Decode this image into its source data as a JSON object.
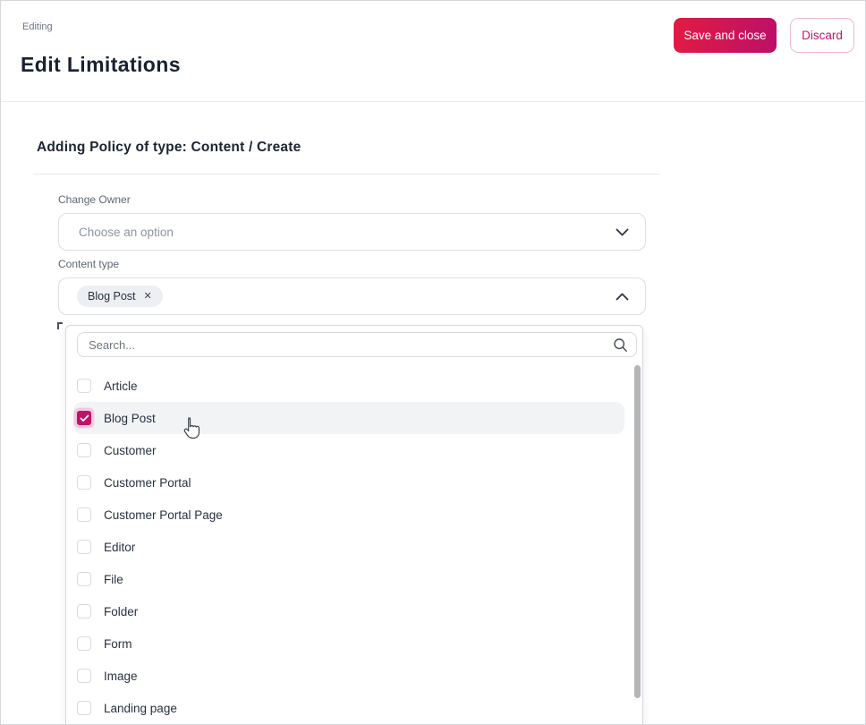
{
  "header": {
    "breadcrumb": "Editing",
    "title": "Edit Limitations",
    "save_label": "Save and close",
    "discard_label": "Discard"
  },
  "form": {
    "section_title": "Adding Policy of type: Content / Create",
    "change_owner_label": "Change Owner",
    "change_owner_placeholder": "Choose an option",
    "content_type_label": "Content type",
    "selected_content_type": "Blog Post"
  },
  "dropdown": {
    "search_placeholder": "Search...",
    "options": [
      {
        "label": "Article",
        "checked": false,
        "highlighted": false
      },
      {
        "label": "Blog Post",
        "checked": true,
        "highlighted": true
      },
      {
        "label": "Customer",
        "checked": false,
        "highlighted": false
      },
      {
        "label": "Customer Portal",
        "checked": false,
        "highlighted": false
      },
      {
        "label": "Customer Portal Page",
        "checked": false,
        "highlighted": false
      },
      {
        "label": "Editor",
        "checked": false,
        "highlighted": false
      },
      {
        "label": "File",
        "checked": false,
        "highlighted": false
      },
      {
        "label": "Folder",
        "checked": false,
        "highlighted": false
      },
      {
        "label": "Form",
        "checked": false,
        "highlighted": false
      },
      {
        "label": "Image",
        "checked": false,
        "highlighted": false
      },
      {
        "label": "Landing page",
        "checked": false,
        "highlighted": false
      }
    ]
  },
  "icons": {
    "chip_remove": "✕"
  },
  "colors": {
    "accent": "#c2186b",
    "save_gradient_start": "#e31b41",
    "save_gradient_end": "#bb1069",
    "checkbox_checked": "#c01368",
    "checkbox_halo": "#f2c9de",
    "row_highlight": "#f2f3f5",
    "title_text": "#18222f",
    "scrollbar_thumb": "#b5b6b8"
  }
}
